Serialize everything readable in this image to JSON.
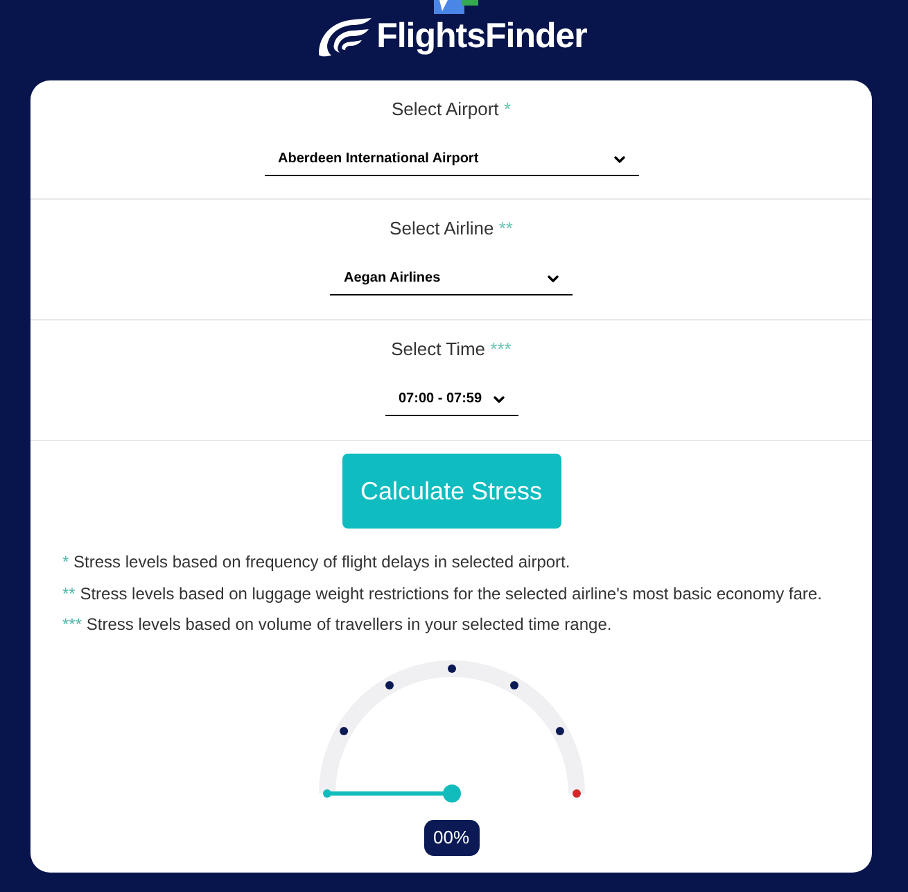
{
  "header": {
    "logo_text": "FlightsFinder"
  },
  "fields": [
    {
      "label": "Select Airport",
      "marker": "*",
      "value": "Aberdeen International Airport"
    },
    {
      "label": "Select Airline",
      "marker": "**",
      "value": "Aegan Airlines"
    },
    {
      "label": "Select Time",
      "marker": "***",
      "value": "07:00 - 07:59"
    }
  ],
  "button": "Calculate Stress",
  "notes": [
    {
      "marker": "*",
      "text": "Stress levels based on frequency of flight delays in selected airport."
    },
    {
      "marker": "**",
      "text": "Stress levels based on luggage weight restrictions for the selected airline's most basic economy fare."
    },
    {
      "marker": "***",
      "text": "Stress levels based on volume of travellers in your selected time range."
    }
  ],
  "gauge": {
    "level": 0,
    "reading": "00%"
  }
}
